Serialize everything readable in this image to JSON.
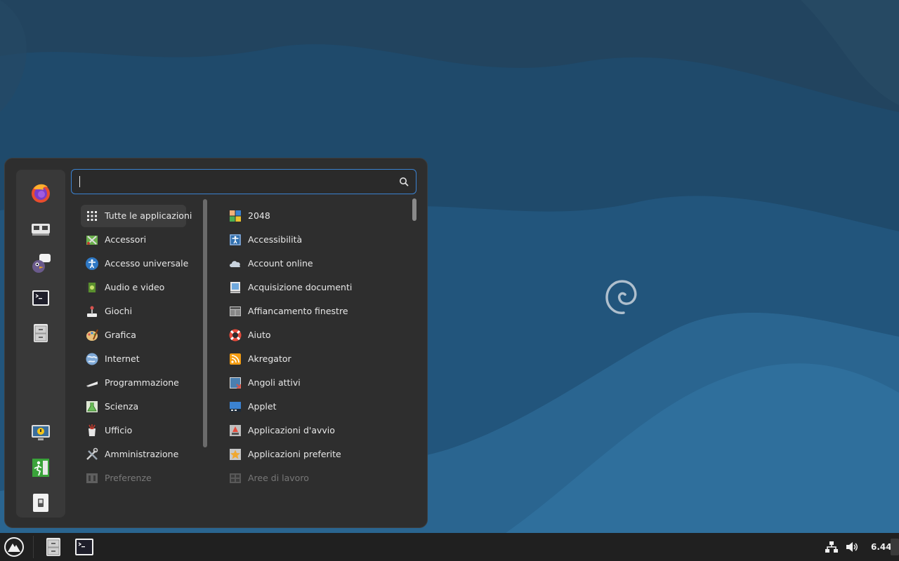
{
  "colors": {
    "desktop_bg": "#1f4d6e",
    "menu_bg": "#2e2e2e",
    "accent": "#3b82d1",
    "taskbar_bg": "#202020"
  },
  "search": {
    "value": "",
    "placeholder": "",
    "icon": "search-icon"
  },
  "favorites": [
    {
      "name": "firefox",
      "icon": "firefox-icon"
    },
    {
      "name": "system-monitor",
      "icon": "system-monitor-icon"
    },
    {
      "name": "pidgin",
      "icon": "pidgin-icon"
    },
    {
      "name": "terminal",
      "icon": "terminal-icon"
    },
    {
      "name": "files",
      "icon": "file-cabinet-icon"
    },
    {
      "name": "lock-screen",
      "icon": "lock-screen-icon"
    },
    {
      "name": "logout",
      "icon": "exit-icon"
    },
    {
      "name": "shutdown",
      "icon": "power-switch-icon"
    }
  ],
  "categories": [
    {
      "label": "Tutte le applicazioni",
      "icon": "grid-icon",
      "selected": true
    },
    {
      "label": "Accessori",
      "icon": "accessories-icon"
    },
    {
      "label": "Accesso universale",
      "icon": "accessibility-icon"
    },
    {
      "label": "Audio e video",
      "icon": "multimedia-icon"
    },
    {
      "label": "Giochi",
      "icon": "joystick-icon"
    },
    {
      "label": "Grafica",
      "icon": "graphics-icon"
    },
    {
      "label": "Internet",
      "icon": "globe-icon"
    },
    {
      "label": "Programmazione",
      "icon": "programming-icon"
    },
    {
      "label": "Scienza",
      "icon": "science-icon"
    },
    {
      "label": "Ufficio",
      "icon": "office-icon"
    },
    {
      "label": "Amministrazione",
      "icon": "tools-icon"
    },
    {
      "label": "Preferenze",
      "icon": "preferences-icon",
      "dimmed": true
    }
  ],
  "apps": [
    {
      "label": "2048",
      "icon": "game-2048-icon"
    },
    {
      "label": "Accessibilità",
      "icon": "accessibility-icon"
    },
    {
      "label": "Account online",
      "icon": "cloud-icon"
    },
    {
      "label": "Acquisizione documenti",
      "icon": "scanner-icon"
    },
    {
      "label": "Affiancamento finestre",
      "icon": "window-tiling-icon"
    },
    {
      "label": "Aiuto",
      "icon": "lifebuoy-icon"
    },
    {
      "label": "Akregator",
      "icon": "rss-icon"
    },
    {
      "label": "Angoli attivi",
      "icon": "hot-corners-icon"
    },
    {
      "label": "Applet",
      "icon": "applet-icon"
    },
    {
      "label": "Applicazioni d'avvio",
      "icon": "startup-apps-icon"
    },
    {
      "label": "Applicazioni preferite",
      "icon": "preferred-apps-icon"
    },
    {
      "label": "Aree di lavoro",
      "icon": "workspaces-icon",
      "dimmed": true
    }
  ],
  "taskbar": {
    "menu_icon": "cinnamon-menu-icon",
    "apps": [
      "file-cabinet-icon",
      "terminal-icon"
    ],
    "tray": [
      "network-icon",
      "volume-icon"
    ],
    "clock": "6.44"
  }
}
